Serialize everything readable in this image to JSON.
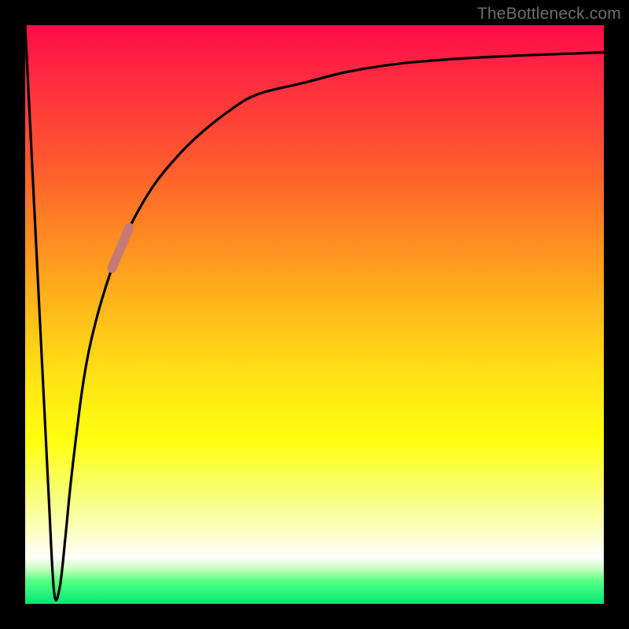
{
  "watermark": "TheBottleneck.com",
  "colors": {
    "frame": "#000000",
    "curve": "#000000",
    "highlight": "#c57a78",
    "watermark": "#6c6c6c"
  },
  "chart_data": {
    "type": "line",
    "title": "",
    "xlabel": "",
    "ylabel": "",
    "xlim": [
      0,
      100
    ],
    "ylim": [
      0,
      100
    ],
    "grid": false,
    "legend": false,
    "series": [
      {
        "name": "bottleneck-curve",
        "x": [
          0,
          2,
          4,
          5,
          6,
          7,
          8,
          10,
          12,
          15,
          18,
          22,
          26,
          30,
          35,
          40,
          48,
          56,
          66,
          80,
          100
        ],
        "y": [
          100,
          60,
          20,
          2,
          3,
          12,
          22,
          38,
          48,
          58,
          65,
          72,
          77,
          81,
          85,
          88,
          90,
          92,
          93.5,
          94.5,
          95.3
        ]
      }
    ],
    "highlight_segment": {
      "series": "bottleneck-curve",
      "x_range": [
        14,
        20
      ],
      "y_range": [
        55,
        68
      ]
    },
    "gradient_stops": [
      {
        "pos": 0.0,
        "color": "#ff0b48"
      },
      {
        "pos": 0.35,
        "color": "#ff8423"
      },
      {
        "pos": 0.6,
        "color": "#ffe015"
      },
      {
        "pos": 0.82,
        "color": "#f7ff82"
      },
      {
        "pos": 0.92,
        "color": "#ffffff"
      },
      {
        "pos": 1.0,
        "color": "#00e874"
      }
    ]
  }
}
